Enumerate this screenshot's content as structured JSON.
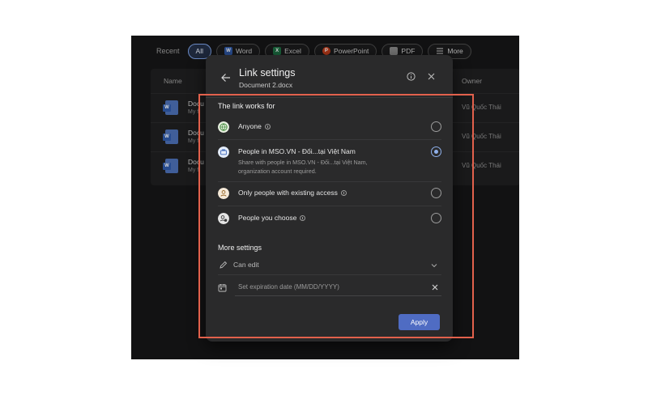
{
  "filter_bar": {
    "recent_label": "Recent",
    "chips": [
      {
        "label": "All",
        "active": true,
        "color": ""
      },
      {
        "label": "Word",
        "active": false,
        "color": "#2f5aa8",
        "icon": "word-icon"
      },
      {
        "label": "Excel",
        "active": false,
        "color": "#1e7145",
        "icon": "excel-icon"
      },
      {
        "label": "PowerPoint",
        "active": false,
        "color": "#c43e1c",
        "icon": "powerpoint-icon"
      },
      {
        "label": "PDF",
        "active": false,
        "color": "#8a8a8a",
        "icon": "pdf-icon"
      },
      {
        "label": "More",
        "active": false,
        "color": "",
        "icon": "menu-icon"
      }
    ]
  },
  "files": {
    "col_name": "Name",
    "col_owner": "Owner",
    "rows": [
      {
        "name": "Docu",
        "location": "My fi",
        "owner": "Vũ Quốc Thái"
      },
      {
        "name": "Docu",
        "location": "My fi",
        "owner": "Vũ Quốc Thái"
      },
      {
        "name": "Docu",
        "location": "My fi",
        "owner": "Vũ Quốc Thái"
      }
    ]
  },
  "dialog": {
    "title": "Link settings",
    "subtitle": "Document 2.docx",
    "section_link": "The link works for",
    "options": [
      {
        "label": "Anyone",
        "desc": "",
        "selected": false,
        "icon": "globe-icon"
      },
      {
        "label": "People in MSO.VN - Đối...tại Việt Nam",
        "desc": "Share with people in MSO.VN - Đối...tại Việt Nam, organization account required.",
        "selected": true,
        "icon": "briefcase-icon"
      },
      {
        "label": "Only people with existing access",
        "desc": "",
        "selected": false,
        "icon": "person-icon"
      },
      {
        "label": "People you choose",
        "desc": "",
        "selected": false,
        "icon": "people-icon"
      }
    ],
    "section_more": "More settings",
    "permission": "Can edit",
    "expiration_placeholder": "Set expiration date (MM/DD/YYYY)",
    "apply_label": "Apply"
  },
  "colors": {
    "accent": "#4f6cc3",
    "radio_selected": "#8fb0ea",
    "highlight": "#e2614c"
  }
}
